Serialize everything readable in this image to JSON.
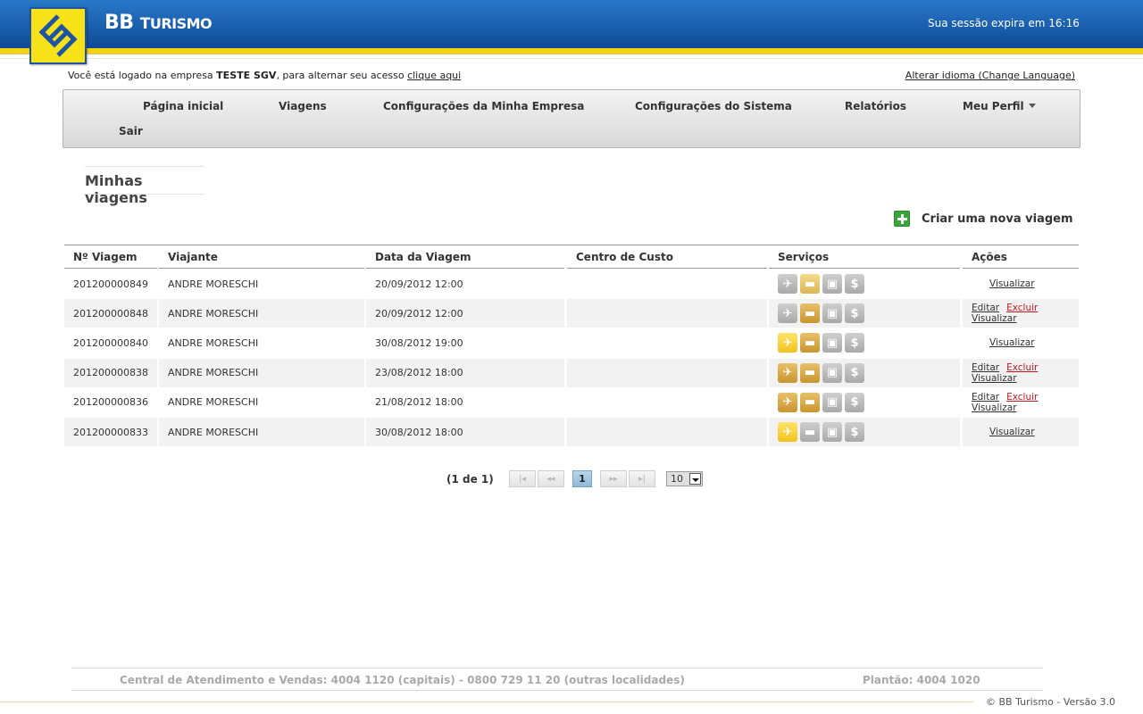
{
  "header": {
    "brand_main": "BB",
    "brand_sub": "Turismo",
    "session": "Sua sessão expira em 16:16"
  },
  "info": {
    "prefix": "Você está logado na empresa ",
    "company": "TESTE SGV",
    "middle": ", para alternar seu acesso ",
    "link": "clique aqui",
    "language_link": "Alterar idioma (Change Language)"
  },
  "menu": {
    "home": "Página inicial",
    "trips": "Viagens",
    "company_settings": "Configurações da Minha Empresa",
    "system_settings": "Configurações do Sistema",
    "reports": "Relatórios",
    "profile": "Meu Perfil",
    "logout": "Sair"
  },
  "page": {
    "title": "Minhas viagens",
    "new_trip": "Criar uma nova viagem"
  },
  "table": {
    "headers": [
      "Nº Viagem",
      "Viajante",
      "Data da Viagem",
      "Centro de Custo",
      "Serviços",
      "Ações"
    ],
    "rows": [
      {
        "id": "201200000849",
        "traveler": "ANDRE MORESCHI",
        "date": "20/09/2012 12:00",
        "cost_center": "",
        "services": [
          "gray",
          "lightgold",
          "gray",
          "gray"
        ],
        "actions": "view"
      },
      {
        "id": "201200000848",
        "traveler": "ANDRE MORESCHI",
        "date": "20/09/2012 12:00",
        "cost_center": "",
        "services": [
          "gray",
          "gold",
          "gray",
          "gray"
        ],
        "actions": "edit"
      },
      {
        "id": "201200000840",
        "traveler": "ANDRE MORESCHI",
        "date": "30/08/2012 19:00",
        "cost_center": "",
        "services": [
          "yellow",
          "gold",
          "gray",
          "gray"
        ],
        "actions": "view"
      },
      {
        "id": "201200000838",
        "traveler": "ANDRE MORESCHI",
        "date": "23/08/2012 18:00",
        "cost_center": "",
        "services": [
          "gold",
          "gold",
          "gray",
          "gray"
        ],
        "actions": "edit"
      },
      {
        "id": "201200000836",
        "traveler": "ANDRE MORESCHI",
        "date": "21/08/2012 18:00",
        "cost_center": "",
        "services": [
          "gold",
          "gold",
          "gray",
          "gray"
        ],
        "actions": "edit"
      },
      {
        "id": "201200000833",
        "traveler": "ANDRE MORESCHI",
        "date": "30/08/2012 18:00",
        "cost_center": "",
        "services": [
          "yellow",
          "gray",
          "gray",
          "gray"
        ],
        "actions": "view"
      }
    ],
    "service_icons": [
      "airplane-icon",
      "bed-icon",
      "car-icon",
      "money-icon"
    ],
    "action_labels": {
      "edit": "Editar",
      "delete": "Excluir",
      "view": "Visualizar"
    }
  },
  "pager": {
    "label": "(1 de 1)",
    "first": "|◂",
    "prev": "◂◂",
    "current": "1",
    "next": "▸▸",
    "last": "▸|",
    "page_size": "10"
  },
  "footer": {
    "contact": "Central de Atendimento e Vendas: 4004 1120 (capitais) - 0800 729 11 20 (outras localidades)",
    "duty": "Plantão: 4004 1020",
    "copyright": "© BB Turismo - Versão 3.0"
  },
  "colors": {
    "header_blue": "#1a5fae",
    "brand_yellow": "#f5d312",
    "delete_red": "#c0191e"
  }
}
